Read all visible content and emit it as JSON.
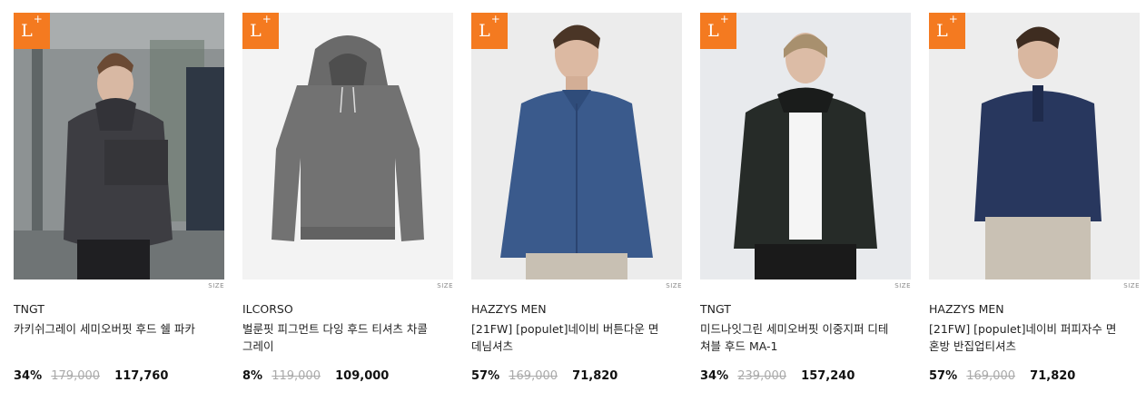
{
  "badge": {
    "letter": "L",
    "plus": "+"
  },
  "products": [
    {
      "brand": "TNGT",
      "name": "카키쉬그레이 세미오버핏 후드 쉘 파카",
      "discount": "34%",
      "original_price": "179,000",
      "final_price": "117,760",
      "size_label": "SIZE",
      "badge_color": "#f47a20"
    },
    {
      "brand": "ILCORSO",
      "name": "벌룬핏 피그먼트 다잉 후드 티셔츠 차콜그레이",
      "discount": "8%",
      "original_price": "119,000",
      "final_price": "109,000",
      "size_label": "SIZE",
      "badge_color": "#f47a20"
    },
    {
      "brand": "HAZZYS MEN",
      "name": "[21FW] [populet]네이비 버튼다운 면 데님셔츠",
      "discount": "57%",
      "original_price": "169,000",
      "final_price": "71,820",
      "size_label": "SIZE",
      "badge_color": "#f47a20"
    },
    {
      "brand": "TNGT",
      "name": "미드나잇그린 세미오버핏 이중지퍼 디테쳐블 후드 MA-1",
      "discount": "34%",
      "original_price": "239,000",
      "final_price": "157,240",
      "size_label": "SIZE",
      "badge_color": "#f47a20"
    },
    {
      "brand": "HAZZYS MEN",
      "name": "[21FW] [populet]네이비 퍼피자수 면혼방 반집업티셔츠",
      "discount": "57%",
      "original_price": "169,000",
      "final_price": "71,820",
      "size_label": "SIZE",
      "badge_color": "#f47a20"
    }
  ]
}
